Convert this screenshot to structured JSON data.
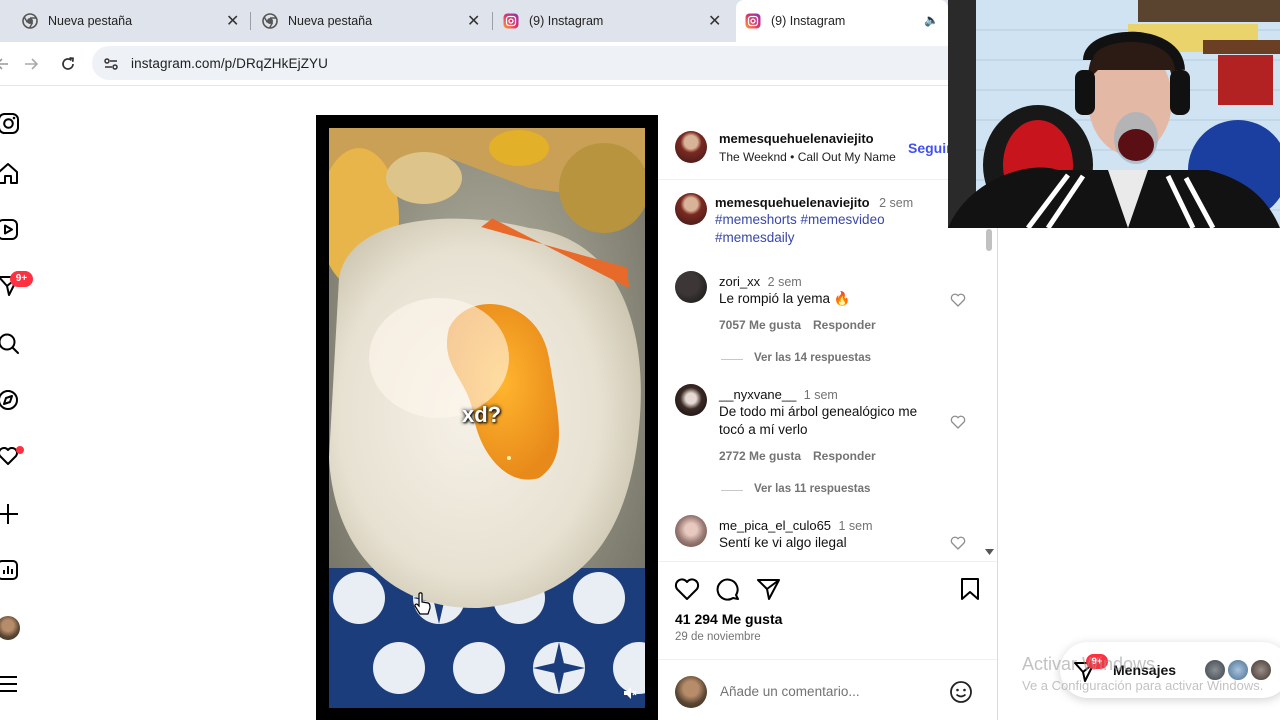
{
  "browser": {
    "tabs": [
      {
        "title": "Nueva pestaña",
        "icon": "chrome-icon"
      },
      {
        "title": "Nueva pestaña",
        "icon": "chrome-icon"
      },
      {
        "title": "(9) Instagram",
        "icon": "instagram-icon"
      },
      {
        "title": "(9) Instagram",
        "icon": "instagram-icon",
        "active": true
      }
    ],
    "url": "instagram.com/p/DRqZHkEjZYU"
  },
  "sidebar": {
    "notifications_badge": "9+",
    "items": [
      "instagram-icon",
      "home-icon",
      "reels-icon",
      "messages-icon",
      "search-icon",
      "explore-icon",
      "notifications-icon",
      "create-icon",
      "dashboard-icon",
      "profile-avatar",
      "menu-icon"
    ]
  },
  "post": {
    "overlay_text": "xd?",
    "header": {
      "username": "memesquehuelenaviejito",
      "audio": "The Weeknd",
      "song": "Call Out My Name",
      "follow": "Seguir"
    },
    "caption": {
      "username": "memesquehuelenaviejito",
      "time": "2 sem",
      "hashtags": [
        "#memeshorts",
        "#memesvideo",
        "#memesdaily"
      ]
    },
    "comments": [
      {
        "username": "zori_xx",
        "time": "2 sem",
        "text": "Le rompió la yema 🔥",
        "likes": "7057 Me gusta",
        "reply": "Responder",
        "view_replies": "Ver las 14 respuestas"
      },
      {
        "username": "__nyxvane__",
        "time": "1 sem",
        "text_line1": "De todo mi árbol genealógico me",
        "text_line2": "tocó a mí verlo",
        "likes": "2772 Me gusta",
        "reply": "Responder",
        "view_replies": "Ver las 11 respuestas"
      },
      {
        "username": "me_pica_el_culo65",
        "time": "1 sem",
        "text": "Sentí ke vi algo ilegal"
      }
    ],
    "likes": "41 294 Me gusta",
    "date": "29 de noviembre",
    "comment_placeholder": "Añade un comentario..."
  },
  "messages_widget": {
    "label": "Mensajes",
    "badge": "9+"
  },
  "watermark": {
    "line1": "Activar Windows",
    "line2": "Ve a Configuración para activar Windows."
  },
  "colors": {
    "accent_blue": "#4150f7",
    "hashtag": "#3847a8",
    "badge_red": "#ff3040"
  }
}
